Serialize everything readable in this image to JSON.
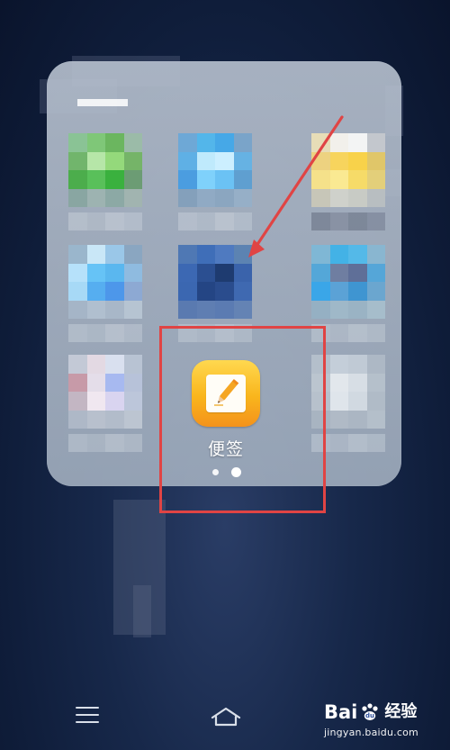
{
  "folder": {
    "title_mask": "folder-name-pixelated",
    "notes_app": {
      "label": "便签"
    },
    "page_indicator": {
      "pages": 2,
      "current_page": 2
    }
  },
  "watermark": {
    "brand": "Bai",
    "paw": "du",
    "suffix": "经验",
    "url": "jingyan.baidu.com"
  },
  "colors": {
    "annotation": "#e04444",
    "notes_top": "#ffd84f",
    "notes_bottom": "#f4921b",
    "folder_bg": "#adb8c7"
  },
  "icons": {
    "menu": "menu-icon",
    "home": "home-icon",
    "notes": "note-pencil-icon"
  }
}
